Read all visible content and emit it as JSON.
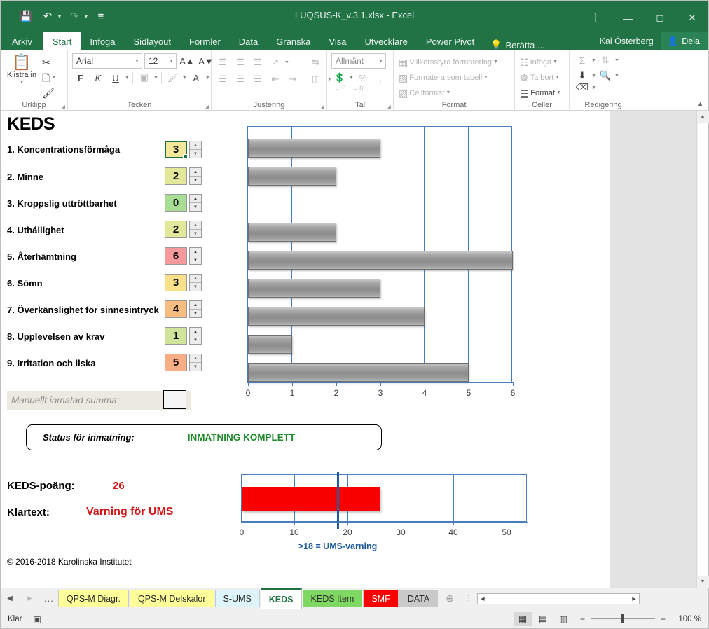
{
  "window": {
    "title": "LUQSUS-K_v.3.1.xlsx - Excel",
    "quick_access": [
      "save-icon",
      "undo-icon",
      "redo-icon",
      "customize-icon"
    ],
    "ribbon_display_options": "ribbon-display-icon",
    "minimize": "minimize-icon",
    "maximize": "maximize-icon",
    "close": "close-icon"
  },
  "ribbon": {
    "tabs": [
      {
        "label": "Arkiv",
        "active": false
      },
      {
        "label": "Start",
        "active": true
      },
      {
        "label": "Infoga",
        "active": false
      },
      {
        "label": "Sidlayout",
        "active": false
      },
      {
        "label": "Formler",
        "active": false
      },
      {
        "label": "Data",
        "active": false
      },
      {
        "label": "Granska",
        "active": false
      },
      {
        "label": "Visa",
        "active": false
      },
      {
        "label": "Utvecklare",
        "active": false
      },
      {
        "label": "Power Pivot",
        "active": false
      }
    ],
    "tell_me": "Berätta ...",
    "account_name": "Kai Österberg",
    "share_label": "Dela",
    "collapse_ribbon": "chevron-up-icon",
    "groups": {
      "clipboard": {
        "label": "Urklipp",
        "paste": "Klistra in",
        "cut": "Klipp ut",
        "copy": "Kopiera",
        "format_painter": "Hämta format"
      },
      "font": {
        "label": "Tecken",
        "font_name": "Arial",
        "font_size": "12",
        "grow": "A",
        "shrink": "A",
        "bold": "F",
        "italic": "K",
        "underline": "U",
        "borders": "borders-icon",
        "fill": "fill-color-icon",
        "font_color": "A"
      },
      "alignment": {
        "label": "Justering",
        "orientation": "orientation-icon",
        "wrap_text": "wrap-text-icon",
        "merge": "merge-cells-icon"
      },
      "number": {
        "label": "Tal",
        "format": "Allmänt",
        "accounting": "accounting-icon",
        "percent": "%",
        "thousands": ",",
        "increase_decimal": ".00",
        "decrease_decimal": ".00"
      },
      "styles": {
        "label": "Format",
        "conditional": "Villkorsstyrd formatering",
        "as_table": "Formatera som tabell",
        "cell_styles": "Cellformat"
      },
      "cells": {
        "label": "Celler",
        "insert": "Infoga",
        "delete": "Ta bort",
        "format": "Format"
      },
      "editing": {
        "label": "Redigering",
        "autosum": "Σ",
        "sort_filter": "sort-filter-icon",
        "fill": "fill-down-icon",
        "find": "find-icon",
        "clear": "clear-icon"
      }
    }
  },
  "sheet": {
    "title": "KEDS",
    "items": [
      {
        "label": "1. Koncentrationsförmåga",
        "value": "3",
        "color": "#f5e79a",
        "selected": true
      },
      {
        "label": "2. Minne",
        "value": "2",
        "color": "#e2e79a",
        "selected": false
      },
      {
        "label": "3. Kroppslig uttröttbarhet",
        "value": "0",
        "color": "#a8dd96",
        "selected": false
      },
      {
        "label": "4. Uthållighet",
        "value": "2",
        "color": "#e2e79a",
        "selected": false
      },
      {
        "label": "5. Återhämtning",
        "value": "6",
        "color": "#f79a9e",
        "selected": false
      },
      {
        "label": "6. Sömn",
        "value": "3",
        "color": "#f9e08a",
        "selected": false
      },
      {
        "label": "7. Överkänslighet för sinnesintryck",
        "value": "4",
        "color": "#f6bd7e",
        "selected": false
      },
      {
        "label": "8. Upplevelsen av krav",
        "value": "1",
        "color": "#cfe59a",
        "selected": false
      },
      {
        "label": "9. Irritation och ilska",
        "value": "5",
        "color": "#f9ad85",
        "selected": false
      }
    ],
    "manual_sum_label": "Manuellt inmatad summa:",
    "manual_sum_value": "",
    "status_label": "Status för inmatning:",
    "status_value": "INMATNING KOMPLETT",
    "status_color": "#1f8a2a",
    "score_label": "KEDS-poäng:",
    "score_value": "26",
    "verdict_label": "Klartext:",
    "verdict_value": "Varning för UMS",
    "verdict_color": "#e00000",
    "copyright": "© 2016-2018 Karolinska Institutet"
  },
  "chart_data": [
    {
      "type": "bar",
      "orientation": "horizontal",
      "title": "",
      "categories": [
        "1. Koncentrationsförmåga",
        "2. Minne",
        "3. Kroppslig uttröttbarhet",
        "4. Uthållighet",
        "5. Återhämtning",
        "6. Sömn",
        "7. Överkänslighet för sinnesintryck",
        "8. Upplevelsen av krav",
        "9. Irritation och ilska"
      ],
      "values": [
        3,
        2,
        0,
        2,
        6,
        3,
        4,
        1,
        5
      ],
      "xlabel": "",
      "ylabel": "",
      "xlim": [
        0,
        6
      ],
      "xticks": [
        "0",
        "1",
        "2",
        "3",
        "4",
        "5",
        "6"
      ],
      "grid": true,
      "legend": false,
      "bar_color": "#989898",
      "axis_color": "#4a7ebb"
    },
    {
      "type": "bar",
      "orientation": "horizontal",
      "title": "",
      "categories": [
        "KEDS-poäng"
      ],
      "values": [
        26
      ],
      "threshold": 18,
      "annotation": ">18 = UMS-varning",
      "xlabel": "",
      "ylabel": "",
      "xlim": [
        0,
        54
      ],
      "xticks": [
        "0",
        "10",
        "20",
        "30",
        "40",
        "50"
      ],
      "grid": true,
      "legend": false,
      "bar_color": "#fb0000",
      "threshold_color": "#1f5c9e",
      "axis_color": "#4a7ebb"
    }
  ],
  "sheet_tabs": {
    "nav": {
      "prev": "◀",
      "next": "▶",
      "more": "..."
    },
    "tabs": [
      {
        "label": "QPS-M Diagr.",
        "color": "#ffff99",
        "active": false
      },
      {
        "label": "QPS-M Delskalor",
        "color": "#ffff99",
        "active": false
      },
      {
        "label": "S-UMS",
        "color": "#ddf4fb",
        "active": false
      },
      {
        "label": "KEDS",
        "color": "#ffffff",
        "active": true
      },
      {
        "label": "KEDS Item",
        "color": "#7fd861",
        "active": false
      },
      {
        "label": "SMF",
        "color": "#fb0000",
        "active": false,
        "text_color": "#ffffff"
      },
      {
        "label": "DATA",
        "color": "#c9c9c9",
        "active": false
      }
    ],
    "add_sheet": "+"
  },
  "statusbar": {
    "mode": "Klar",
    "macro_icon": "record-macro-icon",
    "views": [
      {
        "name": "normal-view-icon",
        "glyph": "▦",
        "active": true
      },
      {
        "name": "page-layout-view-icon",
        "glyph": "▤",
        "active": false
      },
      {
        "name": "page-break-view-icon",
        "glyph": "▥",
        "active": false
      }
    ],
    "zoom_out": "−",
    "zoom_in": "+",
    "zoom_value": "100 %"
  }
}
